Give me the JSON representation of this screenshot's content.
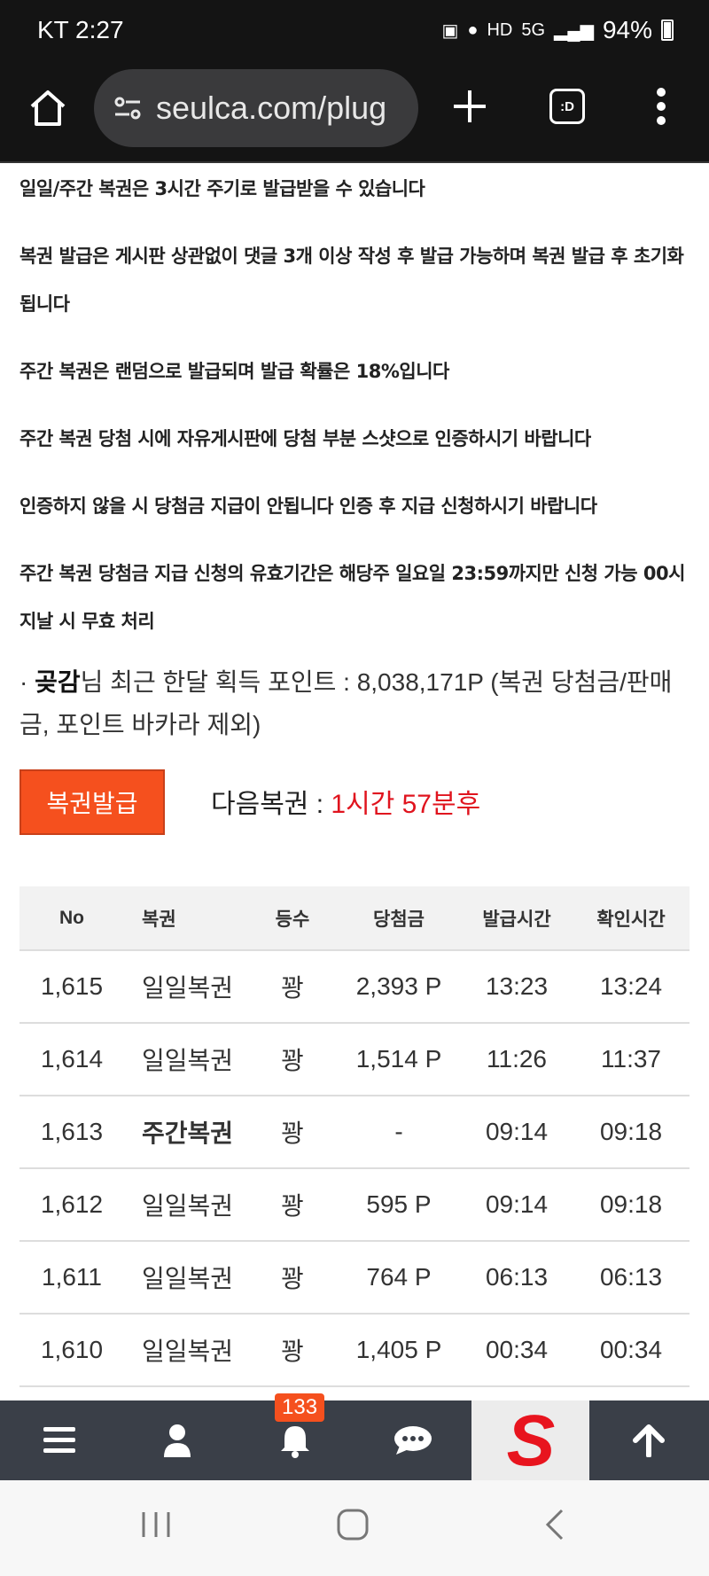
{
  "status_bar": {
    "carrier_time": "KT 2:27",
    "hd_label": "HD",
    "network_label": "5G",
    "battery_percent": "94%"
  },
  "browser": {
    "url": "seulca.com/plug",
    "tabs_label": ":D"
  },
  "notices": [
    "일일/주간 복권은 3시간 주기로 발급받을 수 있습니다",
    "복권 발급은 게시판 상관없이 댓글 3개 이상 작성 후 발급 가능하며 복권 발급 후 초기화됩니다",
    "주간 복권은 랜덤으로 발급되며 발급 확률은 18%입니다",
    "주간 복권 당첨 시에 자유게시판에 당첨 부분 스샷으로 인증하시기 바랍니다",
    "인증하지 않을 시 당첨금 지급이 안됩니다 인증 후 지급 신청하시기 바랍니다",
    "주간 복권 당첨금 지급 신청의 유효기간은 해당주 일요일 23:59까지만 신청 가능 00시 지날 시 무효 처리"
  ],
  "points": {
    "bullet": "·",
    "nickname": "곶감",
    "text": "님 최근 한달 획득 포인트 : 8,038,171P (복권 당첨금/판매금, 포인트 바카라 제외)"
  },
  "issue": {
    "button_label": "복권발급",
    "next_label": "다음복권 : ",
    "next_time": "1시간 57분후"
  },
  "table": {
    "headers": [
      "No",
      "복권",
      "등수",
      "당첨금",
      "발급시간",
      "확인시간"
    ],
    "rows": [
      {
        "no": "1,615",
        "ticket": "일일복권",
        "rank": "꽝",
        "prize": "2,393 P",
        "issued": "13:23",
        "checked": "13:24"
      },
      {
        "no": "1,614",
        "ticket": "일일복권",
        "rank": "꽝",
        "prize": "1,514 P",
        "issued": "11:26",
        "checked": "11:37"
      },
      {
        "no": "1,613",
        "ticket": "주간복권",
        "rank": "꽝",
        "prize": "-",
        "issued": "09:14",
        "checked": "09:18"
      },
      {
        "no": "1,612",
        "ticket": "일일복권",
        "rank": "꽝",
        "prize": "595 P",
        "issued": "09:14",
        "checked": "09:18"
      },
      {
        "no": "1,611",
        "ticket": "일일복권",
        "rank": "꽝",
        "prize": "764 P",
        "issued": "06:13",
        "checked": "06:13"
      },
      {
        "no": "1,610",
        "ticket": "일일복권",
        "rank": "꽝",
        "prize": "1,405 P",
        "issued": "00:34",
        "checked": "00:34"
      }
    ]
  },
  "bottom_nav": {
    "notification_count": "133",
    "logo_letter": "S"
  },
  "colors": {
    "accent_orange": "#f5501e",
    "red_text": "#e0141e",
    "nav_bg": "#3a3f48"
  }
}
